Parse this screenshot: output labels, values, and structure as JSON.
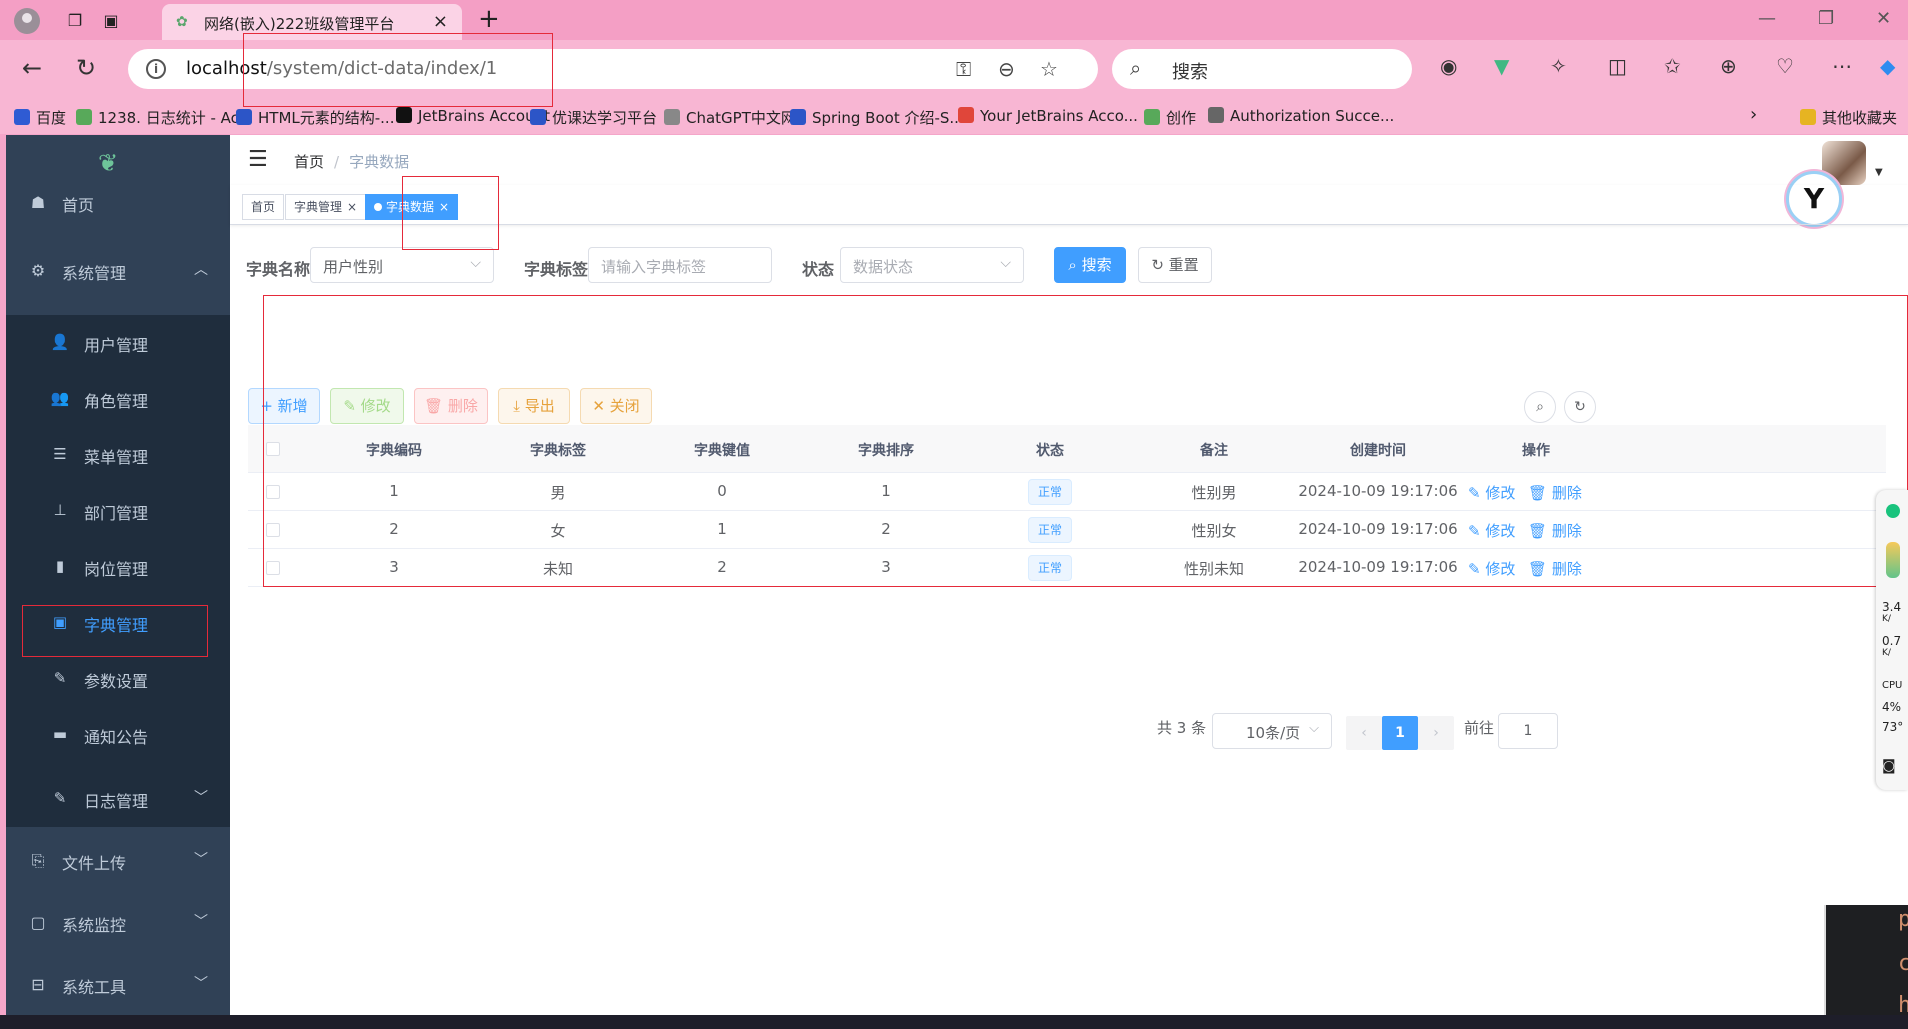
{
  "browser": {
    "tab_title": "网络(嵌入)222班级管理平台",
    "url_host": "localhost",
    "url_path": "/system/dict-data/index/1",
    "search_placeholder": "搜索",
    "bookmarks": [
      {
        "label": "百度",
        "color": "#2f5bd3"
      },
      {
        "label": "1238. 日志统计 - Ac...",
        "color": "#58a95a"
      },
      {
        "label": "HTML元素的结构-...",
        "color": "#2c55c7"
      },
      {
        "label": "JetBrains Account",
        "color": "#111111"
      },
      {
        "label": "优课达学习平台",
        "color": "#2c55c7"
      },
      {
        "label": "ChatGPT中文网",
        "color": "#888888"
      },
      {
        "label": "Spring Boot 介绍-S...",
        "color": "#2c55c7"
      },
      {
        "label": "Your JetBrains Acco...",
        "color": "#e0463a"
      },
      {
        "label": "创作",
        "color": "#58a95a"
      },
      {
        "label": "Authorization Succe...",
        "color": "#666666"
      },
      {
        "label": "其他收藏夹",
        "color": "#e6b422"
      }
    ]
  },
  "sidebar": {
    "items": [
      {
        "label": "首页",
        "icon": "dashboard-icon",
        "glyph": "☗"
      },
      {
        "label": "系统管理",
        "icon": "gear-icon",
        "glyph": "⚙"
      }
    ],
    "sub_items": [
      {
        "label": "用户管理",
        "icon": "user-icon",
        "glyph": "👤"
      },
      {
        "label": "角色管理",
        "icon": "users-icon",
        "glyph": "👥"
      },
      {
        "label": "菜单管理",
        "icon": "list-icon",
        "glyph": "☰"
      },
      {
        "label": "部门管理",
        "icon": "tree-icon",
        "glyph": "⊥"
      },
      {
        "label": "岗位管理",
        "icon": "post-icon",
        "glyph": "▮"
      },
      {
        "label": "字典管理",
        "icon": "dict-icon",
        "glyph": "▣"
      },
      {
        "label": "参数设置",
        "icon": "edit-icon",
        "glyph": "✎"
      },
      {
        "label": "通知公告",
        "icon": "message-icon",
        "glyph": "▬"
      },
      {
        "label": "日志管理",
        "icon": "log-icon",
        "glyph": "✎"
      }
    ],
    "bottom_items": [
      {
        "label": "文件上传",
        "icon": "upload-icon",
        "glyph": "⎘"
      },
      {
        "label": "系统监控",
        "icon": "monitor-icon",
        "glyph": "▢"
      },
      {
        "label": "系统工具",
        "icon": "tool-icon",
        "glyph": "⊟"
      }
    ]
  },
  "navbar": {
    "breadcrumb_home": "首页",
    "breadcrumb_current": "字典数据"
  },
  "tags": [
    {
      "label": "首页"
    },
    {
      "label": "字典管理"
    },
    {
      "label": "字典数据"
    }
  ],
  "search_form": {
    "dict_name_label": "字典名称",
    "dict_name_value": "用户性别",
    "dict_label_label": "字典标签",
    "dict_label_placeholder": "请输入字典标签",
    "status_label": "状态",
    "status_placeholder": "数据状态",
    "search_button": "搜索",
    "reset_button": "重置"
  },
  "toolbar": {
    "add": "新增",
    "edit": "修改",
    "delete": "删除",
    "export": "导出",
    "close": "关闭"
  },
  "table": {
    "columns": [
      "字典编码",
      "字典标签",
      "字典键值",
      "字典排序",
      "状态",
      "备注",
      "创建时间",
      "操作"
    ],
    "rows": [
      {
        "code": "1",
        "label": "男",
        "value": "0",
        "sort": "1",
        "status": "正常",
        "remark": "性别男",
        "created": "2024-10-09 19:17:06"
      },
      {
        "code": "2",
        "label": "女",
        "value": "1",
        "sort": "2",
        "status": "正常",
        "remark": "性别女",
        "created": "2024-10-09 19:17:06"
      },
      {
        "code": "3",
        "label": "未知",
        "value": "2",
        "sort": "3",
        "status": "正常",
        "remark": "性别未知",
        "created": "2024-10-09 19:17:06"
      }
    ],
    "op_edit": "修改",
    "op_delete": "删除"
  },
  "pagination": {
    "total": "共 3 条",
    "page_size": "10条/页",
    "current_page": "1",
    "goto_label": "前往",
    "goto_value": "1"
  },
  "colors": {
    "accent": "#409eff",
    "sidebar_bg": "#304156",
    "annotation_red": "#e52a3a"
  }
}
